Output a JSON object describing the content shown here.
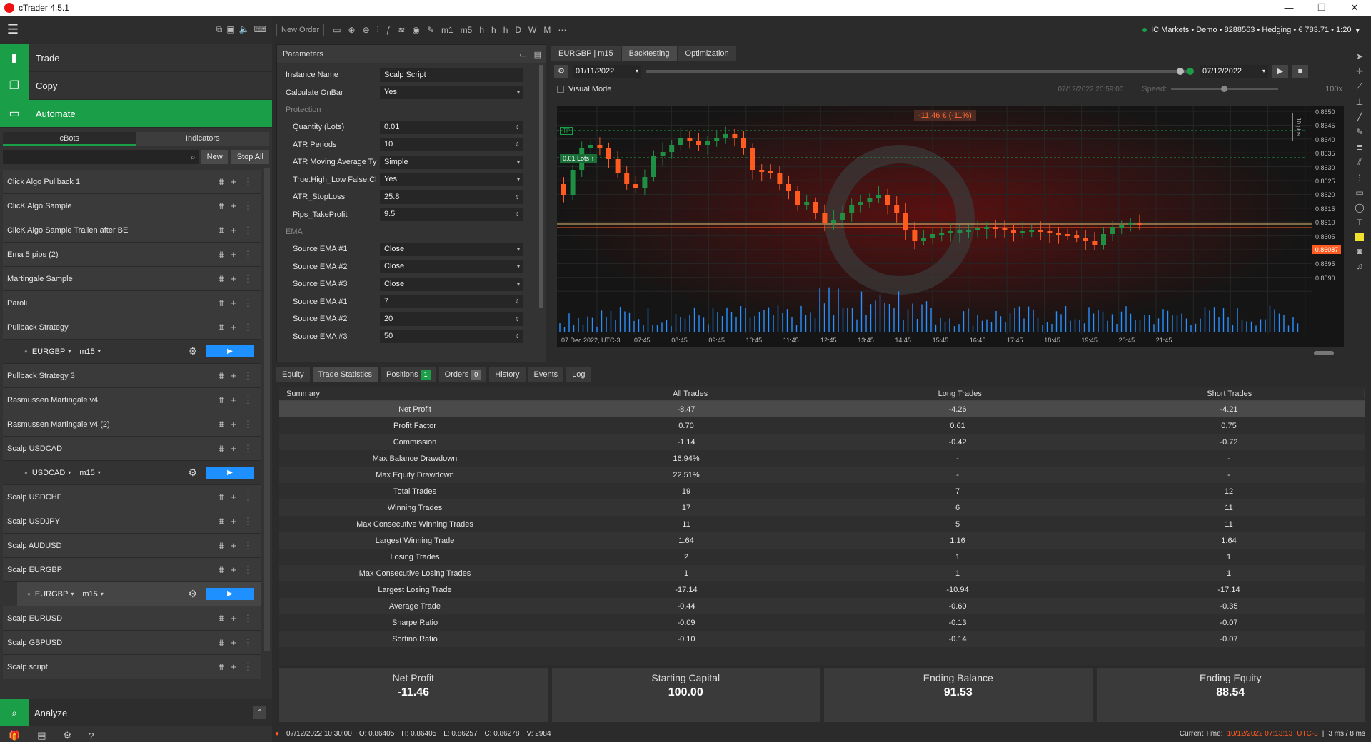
{
  "app": {
    "title": "cTrader 4.5.1"
  },
  "nav": {
    "trade": "Trade",
    "copy": "Copy",
    "automate": "Automate",
    "analyze": "Analyze"
  },
  "bots_tabs": [
    "cBots",
    "Indicators"
  ],
  "bots_actions": {
    "new": "New",
    "stop_all": "Stop All"
  },
  "bots": [
    {
      "name": "Click Algo Pullback 1"
    },
    {
      "name": "ClicK Algo Sample"
    },
    {
      "name": "ClicK Algo Sample Trailen after BE"
    },
    {
      "name": "Ema 5 pips (2)"
    },
    {
      "name": "Martingale Sample"
    },
    {
      "name": "Paroli"
    },
    {
      "name": "Pullback Strategy"
    },
    {
      "instance": true,
      "symbol": "EURGBP",
      "tf": "m15"
    },
    {
      "name": "Pullback Strategy 3"
    },
    {
      "name": "Rasmussen Martingale v4"
    },
    {
      "name": "Rasmussen Martingale v4 (2)"
    },
    {
      "name": "Scalp  USDCAD"
    },
    {
      "instance": true,
      "symbol": "USDCAD",
      "tf": "m15"
    },
    {
      "name": "Scalp  USDCHF"
    },
    {
      "name": "Scalp  USDJPY"
    },
    {
      "name": "Scalp AUDUSD"
    },
    {
      "name": "Scalp EURGBP"
    },
    {
      "instance": true,
      "selected": true,
      "symbol": "EURGBP",
      "tf": "m15"
    },
    {
      "name": "Scalp EURUSD"
    },
    {
      "name": "Scalp GBPUSD"
    },
    {
      "name": "Scalp script"
    }
  ],
  "toolbar": {
    "new_order": "New Order",
    "timeframes": [
      "m1",
      "m5",
      "h",
      "h",
      "h",
      "D",
      "W",
      "M"
    ]
  },
  "account": {
    "text": "IC Markets • Demo • 8288563 • Hedging • € 783.71 • 1:20"
  },
  "params": {
    "title": "Parameters",
    "instance_name": {
      "label": "Instance Name",
      "value": "Scalp Script"
    },
    "calc_onbar": {
      "label": "Calculate OnBar",
      "value": "Yes"
    },
    "protection_title": "Protection",
    "protection": [
      {
        "label": "Quantity (Lots)",
        "value": "0.01",
        "kind": "num"
      },
      {
        "label": "ATR Periods",
        "value": "10",
        "kind": "num"
      },
      {
        "label": "ATR Moving Average Type",
        "value": "Simple",
        "kind": "sel"
      },
      {
        "label": "True:High_Low False:Cl...",
        "value": "Yes",
        "kind": "sel"
      },
      {
        "label": "ATR_StopLoss",
        "value": "25.8",
        "kind": "num"
      },
      {
        "label": "Pips_TakeProfit",
        "value": "9.5",
        "kind": "num"
      }
    ],
    "ema_title": "EMA",
    "ema": [
      {
        "label": "Source EMA #1",
        "value": "Close",
        "kind": "sel"
      },
      {
        "label": "Source EMA #2",
        "value": "Close",
        "kind": "sel"
      },
      {
        "label": "Source EMA #3",
        "value": "Close",
        "kind": "sel"
      },
      {
        "label": "Source EMA #1",
        "value": "7",
        "kind": "num"
      },
      {
        "label": "Source EMA #2",
        "value": "20",
        "kind": "num"
      },
      {
        "label": "Source EMA #3",
        "value": "50",
        "kind": "num"
      }
    ]
  },
  "chart_tabs": {
    "symbol": "EURGBP",
    "tf": "m15",
    "backtesting": "Backtesting",
    "optimization": "Optimization"
  },
  "backtest": {
    "start": "01/11/2022",
    "end": "07/12/2022",
    "visual_mode": "Visual Mode",
    "visual_time": "07/12/2022 20:59:00",
    "speed_label": "Speed:",
    "speed_value": "100x"
  },
  "chart": {
    "pl_badge": "-11.46 € (-11%)",
    "tp_label": "TP",
    "lots_label": "0.01 Lots ↑",
    "pips_label": "10 pips",
    "current_price": "0.86087",
    "price_ticks": [
      "0.8650",
      "0.8645",
      "0.8640",
      "0.8635",
      "0.8630",
      "0.8625",
      "0.8620",
      "0.8615",
      "0.8610",
      "0.8605",
      "0.8600",
      "0.8595",
      "0.8590"
    ],
    "time_ticks": [
      "07 Dec 2022, UTC-3",
      "07:45",
      "08:45",
      "09:45",
      "10:45",
      "11:45",
      "12:45",
      "13:45",
      "14:45",
      "15:45",
      "16:45",
      "17:45",
      "18:45",
      "19:45",
      "20:45",
      "21:45"
    ],
    "colors": {
      "bull": "#1f8f43",
      "bear": "#ff5a1f",
      "volume": "#2a8fff",
      "price_line": "#ff5a1f",
      "tp_line": "#1a9e48"
    }
  },
  "bottom_tabs": {
    "equity": "Equity",
    "trade_stats": "Trade Statistics",
    "positions": "Positions",
    "positions_count": "1",
    "orders": "Orders",
    "orders_count": "0",
    "history": "History",
    "events": "Events",
    "log": "Log"
  },
  "stats": {
    "headers": [
      "Summary",
      "All Trades",
      "Long Trades",
      "Short Trades"
    ],
    "rows": [
      {
        "label": "Net Profit",
        "all": "-8.47",
        "long": "-4.26",
        "short": "-4.21"
      },
      {
        "label": "Profit Factor",
        "all": "0.70",
        "long": "0.61",
        "short": "0.75"
      },
      {
        "label": "Commission",
        "all": "-1.14",
        "long": "-0.42",
        "short": "-0.72"
      },
      {
        "label": "Max Balance Drawdown",
        "all": "16.94%",
        "long": "-",
        "short": "-"
      },
      {
        "label": "Max Equity Drawdown",
        "all": "22.51%",
        "long": "-",
        "short": "-"
      },
      {
        "label": "Total Trades",
        "all": "19",
        "long": "7",
        "short": "12"
      },
      {
        "label": "Winning Trades",
        "all": "17",
        "long": "6",
        "short": "11"
      },
      {
        "label": "Max Consecutive Winning Trades",
        "all": "11",
        "long": "5",
        "short": "11"
      },
      {
        "label": "Largest Winning Trade",
        "all": "1.64",
        "long": "1.16",
        "short": "1.64"
      },
      {
        "label": "Losing Trades",
        "all": "2",
        "long": "1",
        "short": "1"
      },
      {
        "label": "Max Consecutive Losing Trades",
        "all": "1",
        "long": "1",
        "short": "1"
      },
      {
        "label": "Largest Losing Trade",
        "all": "-17.14",
        "long": "-10.94",
        "short": "-17.14"
      },
      {
        "label": "Average Trade",
        "all": "-0.44",
        "long": "-0.60",
        "short": "-0.35"
      },
      {
        "label": "Sharpe Ratio",
        "all": "-0.09",
        "long": "-0.13",
        "short": "-0.07"
      },
      {
        "label": "Sortino Ratio",
        "all": "-0.10",
        "long": "-0.14",
        "short": "-0.07"
      }
    ]
  },
  "summary": [
    {
      "title": "Net Profit",
      "value": "-11.46"
    },
    {
      "title": "Starting Capital",
      "value": "100.00"
    },
    {
      "title": "Ending Balance",
      "value": "91.53"
    },
    {
      "title": "Ending Equity",
      "value": "88.54"
    }
  ],
  "status": {
    "datetime": "07/12/2022 10:30:00",
    "o": "O: 0.86405",
    "h": "H: 0.86405",
    "l": "L: 0.86257",
    "c": "C: 0.86278",
    "v": "V: 2984",
    "current_time_label": "Current Time:",
    "current_time": "10/12/2022 07:13:13",
    "tz": "UTC-3",
    "latency": "3 ms / 8 ms"
  }
}
